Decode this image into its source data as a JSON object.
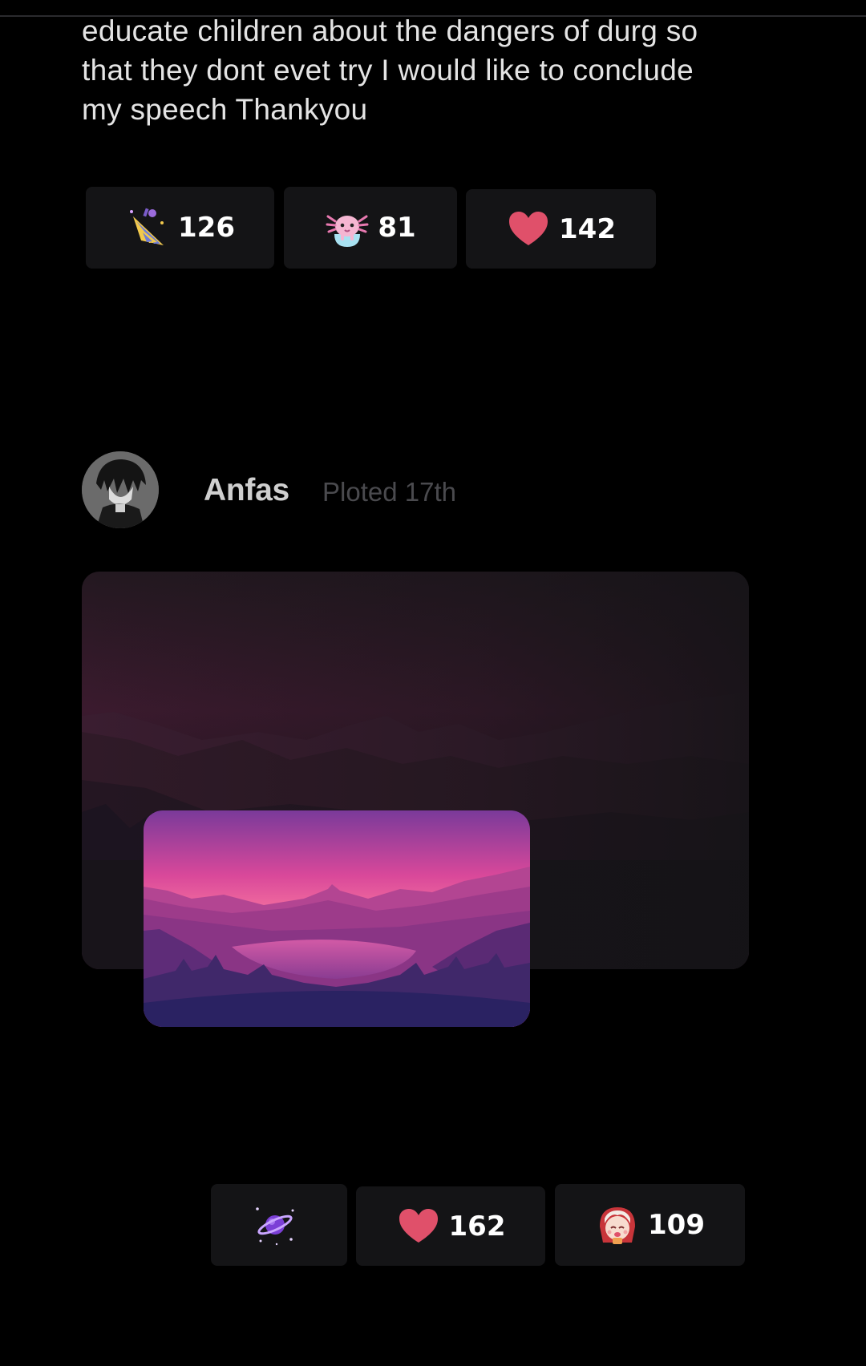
{
  "post1": {
    "text_lines": [
      "educate children about the dangers of durg so",
      "that they dont evet try I would like to conclude",
      "my speech Thankyou"
    ],
    "reactions": [
      {
        "icon": "party-popper-icon",
        "count": "126"
      },
      {
        "icon": "axolotl-icon",
        "count": "81"
      },
      {
        "icon": "heart-icon",
        "count": "142"
      }
    ]
  },
  "post2": {
    "author": "Anfas",
    "date": "Ploted 17th",
    "avatar_icon": "anime-avatar-icon",
    "images": [
      "mountain-sunset-dark-image",
      "mountain-sunset-pink-image"
    ],
    "reactions": [
      {
        "icon": "purple-planet-icon",
        "count": ""
      },
      {
        "icon": "heart-icon",
        "count": "162"
      },
      {
        "icon": "anime-girl-icon",
        "count": "109"
      }
    ]
  },
  "colors": {
    "background": "#000000",
    "reaction_bg": "#141416",
    "heart": "#e0506a",
    "text": "#e4e4e4",
    "muted": "#4a4a4e"
  }
}
